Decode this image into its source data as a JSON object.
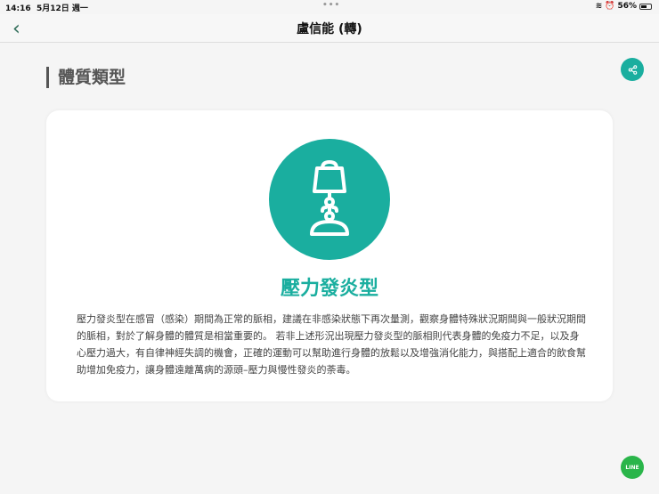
{
  "status": {
    "time": "14:16",
    "date": "5月12日 週一",
    "battery": "56%",
    "battery_level": 0.56
  },
  "nav": {
    "title": "盧信能 (轉)"
  },
  "section_title": "體質類型",
  "result": {
    "title": "壓力發炎型",
    "icon": "lamp-icon",
    "lines": [
      "壓力發炎型在感冒（感染）期間為正常的脈相，建議在非感染狀態下再次量測，觀察身體特殊狀況期間與一般狀況期間",
      "的脈相，對於了解身體的體質是相當重要的。 若非上述形況出現壓力發炎型的脈相則代表身體的免疫力不足，以及身",
      "心壓力過大，有自律神經失調的機會，正確的運動可以幫助進行身體的放鬆以及增強消化能力，與搭配上適合的飲食幫",
      "助增加免疫力，讓身體遠離萬病的源頭–壓力與慢性發炎的荼毒。"
    ]
  },
  "line_button": "LINE",
  "colors": {
    "accent": "#1aae9f"
  }
}
